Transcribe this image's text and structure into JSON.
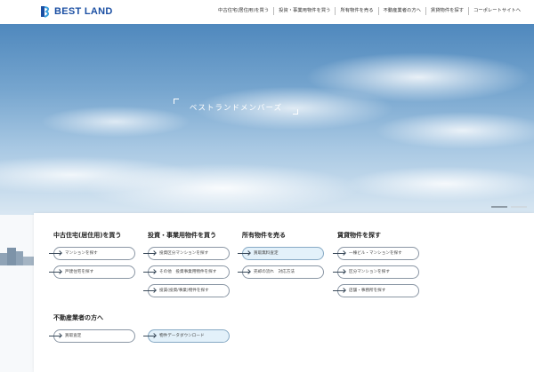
{
  "header": {
    "logo_text": "BEST LAND",
    "nav": [
      "中古住宅(居住用)を買う",
      "投資・事業用物件を買う",
      "所有物件を売る",
      "不動産業者の方へ",
      "賃貸物件を探す",
      "コーポレートサイトへ"
    ]
  },
  "hero": {
    "title": "ベストランドメンバーズ"
  },
  "menu": {
    "col1": {
      "title": "中古住宅(居住用)を買う",
      "items": [
        "マンションを探す",
        "戸建住宅を探す"
      ]
    },
    "col2": {
      "title": "投資・事業用物件を買う",
      "items": [
        "投資区分マンションを探す",
        "その他　投資事業用物件を探す",
        "投賃(投資/事業)物件を探す"
      ]
    },
    "col3": {
      "title": "所有物件を売る",
      "items": [
        "買取無料査定",
        "売却の流れ　対応方法"
      ]
    },
    "col4": {
      "title": "賃貸物件を探す",
      "items": [
        "一棟ビル・マンションを探す",
        "区分マンションを探す",
        "店舗・事務所を探す"
      ]
    },
    "col5": {
      "title": "不動産業者の方へ",
      "items": [
        "買取査定",
        "物件データダウンロード"
      ]
    }
  },
  "colors": {
    "brand": "#1b4fa3",
    "highlight_pill": "#e3f1fa"
  }
}
